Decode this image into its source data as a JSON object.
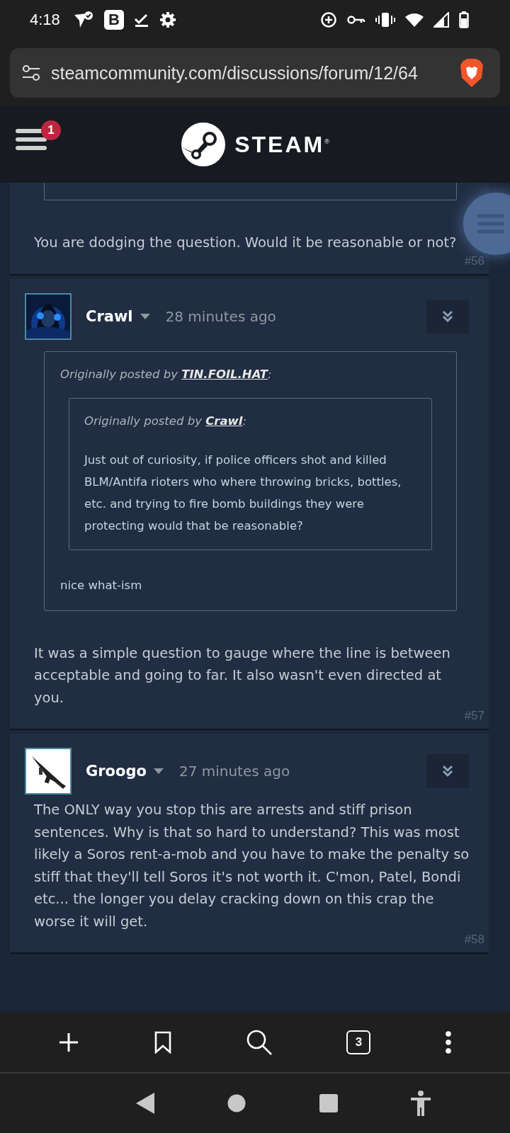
{
  "status_bar": {
    "time": "4:18",
    "app_letter": "B"
  },
  "address_bar": {
    "url": "steamcommunity.com/discussions/forum/12/64"
  },
  "header": {
    "menu_badge": "1",
    "logo_text": "STEAM$^{®}$"
  },
  "posts": [
    {
      "kind": "continued",
      "body": "You are dodging the question. Would it be reasonable or not?",
      "number": "#56"
    },
    {
      "kind": "full",
      "author": "Crawl",
      "time": "28 minutes ago",
      "quote": {
        "prefix": "Originally posted by",
        "author": "TIN.FOIL.HAT",
        "suffix": ":",
        "quote": {
          "prefix": "Originally posted by",
          "author": "Crawl",
          "suffix": ":",
          "text": "Just out of curiosity, if police officers shot and killed BLM/Antifa rioters who where throwing bricks, bottles, etc. and trying to fire bomb buildings they were protecting would that be reasonable?"
        },
        "text": "nice what-ism"
      },
      "body": "It was a simple question to gauge where the line is between acceptable and going to far. It also wasn't even directed at you.",
      "number": "#57"
    },
    {
      "kind": "full",
      "author": "Groogo",
      "time": "27 minutes ago",
      "body": "The ONLY way you stop this are arrests and stiff prison sentences. Why is that so hard to understand? This was most likely a Soros rent-a-mob and you have to make the penalty so stiff that they'll tell Soros it's not worth it. C'mon, Patel, Bondi etc... the longer you delay cracking down on this crap the worse it will get.",
      "number": "#58"
    }
  ],
  "toolbar": {
    "tab_count": "3"
  }
}
